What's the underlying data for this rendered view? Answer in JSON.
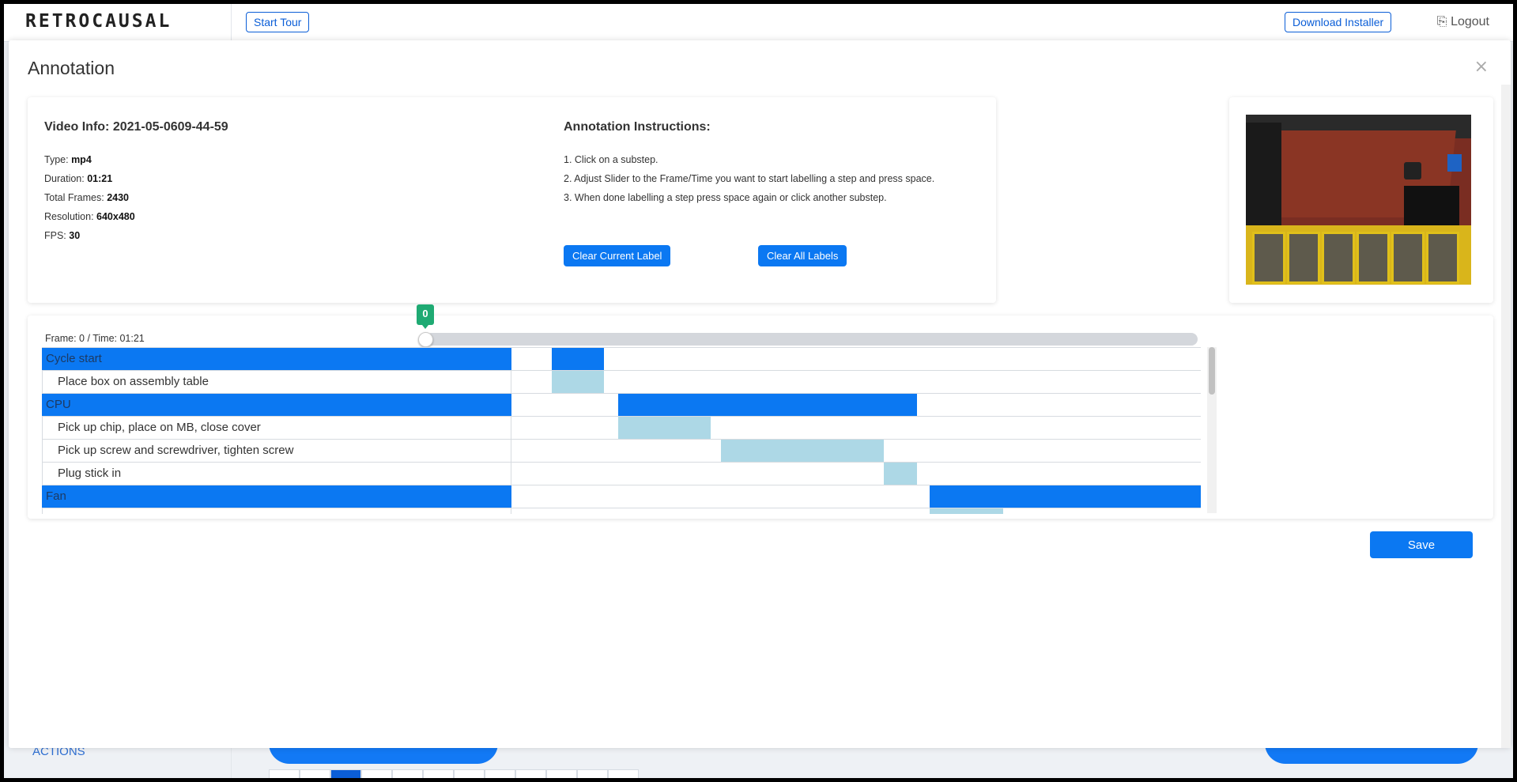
{
  "app": {
    "logo": "RETROCAUSAL"
  },
  "header": {
    "start_tour": "Start Tour",
    "download_installer": "Download Installer",
    "logout": "Logout"
  },
  "sidebar": {
    "actions": "ACTIONS"
  },
  "modal": {
    "title": "Annotation",
    "close": "×",
    "video_info": {
      "heading": "Video Info: 2021-05-0609-44-59",
      "fields": [
        {
          "label": "Type:",
          "value": "mp4"
        },
        {
          "label": "Duration:",
          "value": "01:21"
        },
        {
          "label": "Total Frames:",
          "value": "2430"
        },
        {
          "label": "Resolution:",
          "value": "640x480"
        },
        {
          "label": "FPS:",
          "value": "30"
        }
      ]
    },
    "instructions": {
      "heading": "Annotation Instructions:",
      "steps": [
        "1. Click on a substep.",
        "2. Adjust Slider to the Frame/Time you want to start labelling a step and press space.",
        "3. When done labelling a step press space again or click another substep."
      ],
      "clear_current": "Clear Current Label",
      "clear_all": "Clear All Labels"
    },
    "timeline": {
      "frame_label": "Frame: 0 / Time: 01:21",
      "slider_value": "0",
      "slider_fraction": 0,
      "total_frames": 2430,
      "rows": [
        {
          "label": "Cycle start",
          "type": "main",
          "segments": [
            [
              64,
              148
            ]
          ]
        },
        {
          "label": "Place box on assembly table",
          "type": "sub",
          "segments": [
            [
              64,
              148
            ]
          ]
        },
        {
          "label": "CPU",
          "type": "main",
          "segments": [
            [
              170,
              647
            ]
          ]
        },
        {
          "label": "Pick up chip, place on MB, close cover",
          "type": "sub",
          "segments": [
            [
              170,
              318
            ]
          ]
        },
        {
          "label": "Pick up screw and screwdriver, tighten screw",
          "type": "sub",
          "segments": [
            [
              334,
              594
            ]
          ]
        },
        {
          "label": "Plug stick in",
          "type": "sub",
          "segments": [
            [
              594,
              647
            ]
          ]
        },
        {
          "label": "Fan",
          "type": "main",
          "segments": [
            [
              667,
              1354
            ]
          ]
        },
        {
          "label": "",
          "type": "sub",
          "segments": [
            [
              667,
              785
            ]
          ]
        }
      ]
    },
    "save": "Save"
  },
  "colors": {
    "primary": "#0b78f2",
    "substep": "#add8e6",
    "bubble": "#1faa73"
  }
}
